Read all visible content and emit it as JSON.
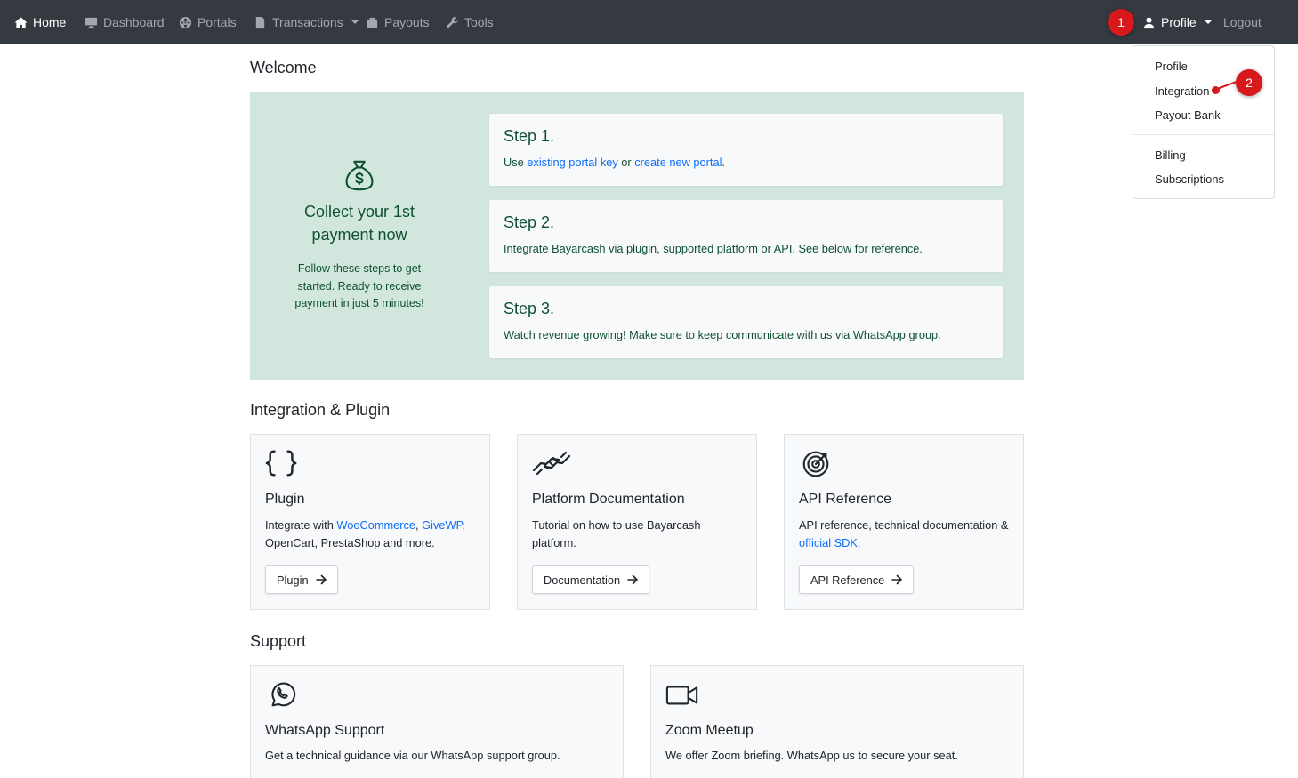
{
  "nav": {
    "home": "Home",
    "dashboard": "Dashboard",
    "portals": "Portals",
    "transactions": "Transactions",
    "payouts": "Payouts",
    "tools": "Tools",
    "profile": "Profile",
    "logout": "Logout"
  },
  "markers": {
    "one": "1",
    "two": "2"
  },
  "dropdown": {
    "items": [
      "Profile",
      "Integration",
      "Payout Bank",
      "Billing",
      "Subscriptions"
    ]
  },
  "welcome": {
    "title": "Welcome",
    "heading": "Collect your 1st payment now",
    "subtext": "Follow these steps to get started. Ready to receive payment in just 5 minutes!",
    "steps": [
      {
        "title": "Step 1.",
        "text_prefix": "Use ",
        "link1": "existing portal key",
        "text_mid": " or ",
        "link2": "create new portal",
        "text_suffix": "."
      },
      {
        "title": "Step 2.",
        "text": "Integrate Bayarcash via plugin, supported platform or API. See below for reference."
      },
      {
        "title": "Step 3.",
        "text": "Watch revenue growing! Make sure to keep communicate with us via WhatsApp group."
      }
    ]
  },
  "integration": {
    "title": "Integration & Plugin",
    "cards": [
      {
        "title": "Plugin",
        "text_prefix": "Integrate with ",
        "link1": "WooCommerce",
        "sep": ", ",
        "link2": "GiveWP",
        "text_suffix": ",",
        "text_line2": "OpenCart, PrestaShop and more.",
        "button": "Plugin"
      },
      {
        "title": "Platform Documentation",
        "text": "Tutorial on how to use Bayarcash platform.",
        "button": "Documentation"
      },
      {
        "title": "API Reference",
        "text_prefix": "API reference, technical documentation & ",
        "link": "official SDK",
        "text_suffix": ".",
        "button": "API Reference"
      }
    ]
  },
  "support": {
    "title": "Support",
    "cards": [
      {
        "title": "WhatsApp Support",
        "text": "Get a technical guidance via our WhatsApp support group."
      },
      {
        "title": "Zoom Meetup",
        "text": "We offer Zoom briefing. WhatsApp us to secure your seat."
      }
    ]
  },
  "colors": {
    "navbar": "#343a40",
    "success_bg": "#d1e7dd",
    "success_text": "#0f5132",
    "link": "#0d6efd",
    "marker": "#d7191c"
  }
}
